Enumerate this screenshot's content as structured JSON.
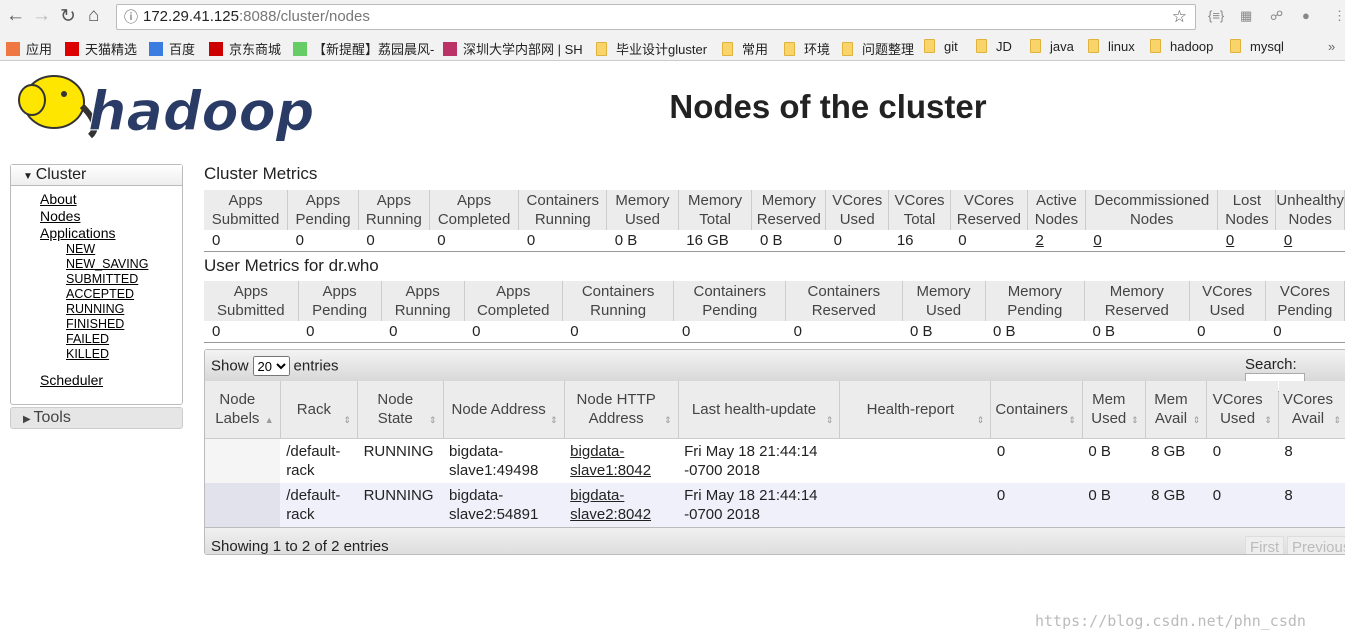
{
  "browser": {
    "url_host": "172.29.41.125",
    "url_path": ":8088/cluster/nodes",
    "bookmarks": [
      "应用",
      "天猫精选",
      "百度",
      "京东商城",
      "【新提醒】荔园晨风-",
      "深圳大学内部网 | SH",
      "毕业设计gluster",
      "常用",
      "环境",
      "问题整理",
      "git",
      "JD",
      "java",
      "linux",
      "hadoop",
      "mysql"
    ]
  },
  "logo_text": "hadoop",
  "page_title": "Nodes of the cluster",
  "sidebar": {
    "cluster": "Cluster",
    "links": [
      "About",
      "Nodes",
      "Applications"
    ],
    "app_states": [
      "NEW",
      "NEW_SAVING",
      "SUBMITTED",
      "ACCEPTED",
      "RUNNING",
      "FINISHED",
      "FAILED",
      "KILLED"
    ],
    "scheduler": "Scheduler",
    "tools": "Tools"
  },
  "cluster_metrics": {
    "title": "Cluster Metrics",
    "headers": [
      "Apps Submitted",
      "Apps Pending",
      "Apps Running",
      "Apps Completed",
      "Containers Running",
      "Memory Used",
      "Memory Total",
      "Memory Reserved",
      "VCores Used",
      "VCores Total",
      "VCores Reserved",
      "Active Nodes",
      "Decommissioned Nodes",
      "Lost Nodes",
      "Unhealthy Nodes"
    ],
    "values": [
      "0",
      "0",
      "0",
      "0",
      "0",
      "0 B",
      "16 GB",
      "0 B",
      "0",
      "16",
      "0",
      "2",
      "0",
      "0",
      "0"
    ],
    "links": [
      11,
      12,
      13,
      14
    ]
  },
  "user_metrics": {
    "title": "User Metrics for dr.who",
    "headers": [
      "Apps Submitted",
      "Apps Pending",
      "Apps Running",
      "Apps Completed",
      "Containers Running",
      "Containers Pending",
      "Containers Reserved",
      "Memory Used",
      "Memory Pending",
      "Memory Reserved",
      "VCores Used",
      "VCores Pending"
    ],
    "values": [
      "0",
      "0",
      "0",
      "0",
      "0",
      "0",
      "0",
      "0 B",
      "0 B",
      "0 B",
      "0",
      "0"
    ]
  },
  "nodes": {
    "show": "Show",
    "entries_label": "entries",
    "page_size": "20",
    "search_label": "Search:",
    "headers": [
      "Node Labels",
      "Rack",
      "Node State",
      "Node Address",
      "Node HTTP Address",
      "Last health-update",
      "Health-report",
      "Containers",
      "Mem Used",
      "Mem Avail",
      "VCores Used",
      "VCores Avail"
    ],
    "rows": [
      [
        "",
        "/default-rack",
        "RUNNING",
        "bigdata-slave1:49498",
        "bigdata-slave1:8042",
        "Fri May 18 21:44:14 -0700 2018",
        "",
        "0",
        "0 B",
        "8 GB",
        "0",
        "8"
      ],
      [
        "",
        "/default-rack",
        "RUNNING",
        "bigdata-slave2:54891",
        "bigdata-slave2:8042",
        "Fri May 18 21:44:14 -0700 2018",
        "",
        "0",
        "0 B",
        "8 GB",
        "0",
        "8"
      ]
    ],
    "info": "Showing 1 to 2 of 2 entries",
    "first": "First",
    "previous": "Previous"
  },
  "watermark": "https://blog.csdn.net/phn_csdn"
}
